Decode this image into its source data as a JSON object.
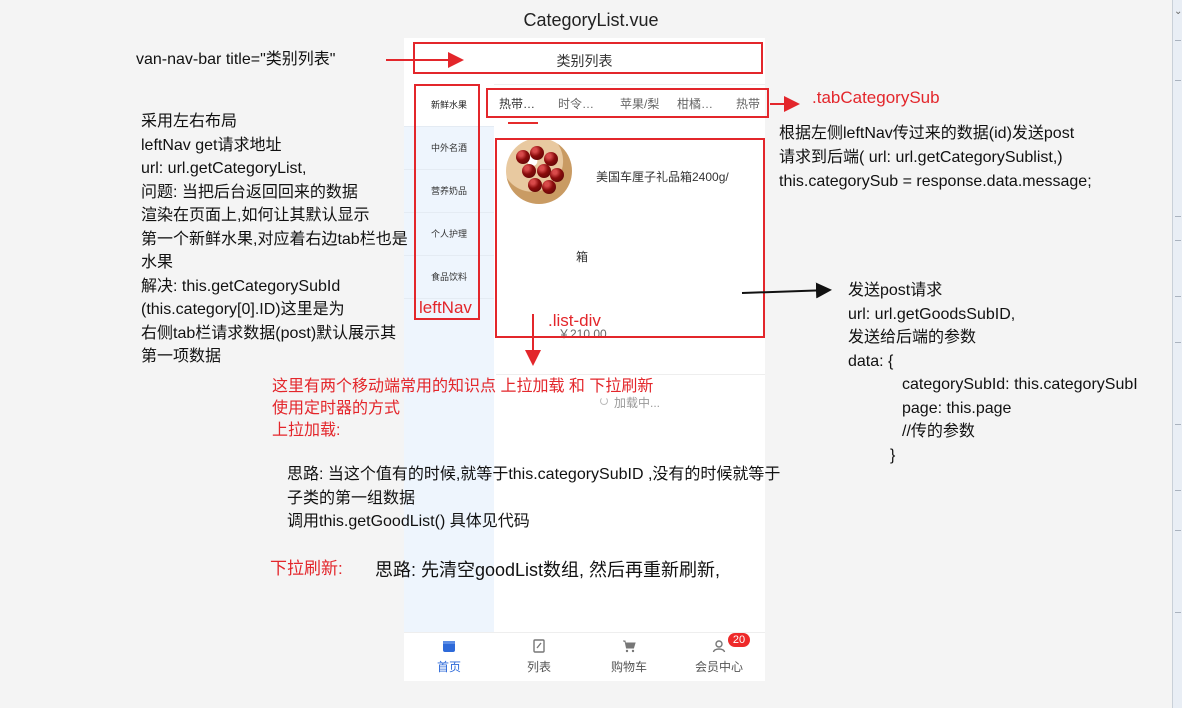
{
  "page": {
    "title": "CategoryList.vue"
  },
  "phone": {
    "navbar_title": "类别列表",
    "left_nav": [
      "新鲜水果",
      "中外名酒",
      "营养奶品",
      "个人护理",
      "食品饮料"
    ],
    "tabs": [
      "热带…",
      "时令…",
      "苹果/梨",
      "柑橘…",
      "热带"
    ],
    "goods": {
      "name": "美国车厘子礼品箱2400g/",
      "name_cont": "箱",
      "price": "￥210.00"
    },
    "loading_text": "加载中...",
    "tabbar": [
      {
        "label": "首页",
        "icon": "home-icon"
      },
      {
        "label": "列表",
        "icon": "list-icon"
      },
      {
        "label": "购物车",
        "icon": "cart-icon"
      },
      {
        "label": "会员中心",
        "icon": "user-icon",
        "badge": "20"
      }
    ]
  },
  "annotations": {
    "navbar_note": "van-nav-bar title=\"类别列表\"",
    "tab_label": ".tabCategorySub",
    "left_nav_label": "leftNav",
    "list_div_label": ".list-div",
    "left_explain": [
      "采用左右布局",
      "leftNav get请求地址",
      "url: url.getCategoryList,",
      "问题: 当把后台返回回来的数据",
      "渲染在页面上,如何让其默认显示",
      "第一个新鲜水果,对应着右边tab栏也是",
      "水果",
      "解决: this.getCategorySubId",
      "(this.category[0].ID)这里是为",
      "右侧tab栏请求数据(post)默认展示其",
      "第一项数据"
    ],
    "right_top_explain": [
      "根据左侧leftNav传过来的数据(id)发送post",
      "请求到后端( url: url.getCategorySublist,)",
      " this.categorySub = response.data.message;"
    ],
    "right_mid_explain": [
      "发送post请求",
      " url: url.getGoodsSubID,",
      "发送给后端的参数",
      "data: {",
      "categorySubId: this.categorySubI",
      "page: this.page",
      "//传的参数",
      "}"
    ],
    "bottom_red": [
      "这里有两个移动端常用的知识点   上拉加载 和 下拉刷新",
      "使用定时器的方式",
      "上拉加载:"
    ],
    "bottom_black": [
      "思路: 当这个值有的时候,就等于this.categorySubID ,没有的时候就等于",
      "子类的第一组数据",
      "调用this.getGoodList() 具体见代码"
    ],
    "refresh_label": "下拉刷新:",
    "refresh_text": "思路: 先清空goodList数组, 然后再重新刷新,"
  },
  "colors": {
    "annotation_red": "#e3262b",
    "active_blue": "#2e6ad9"
  }
}
